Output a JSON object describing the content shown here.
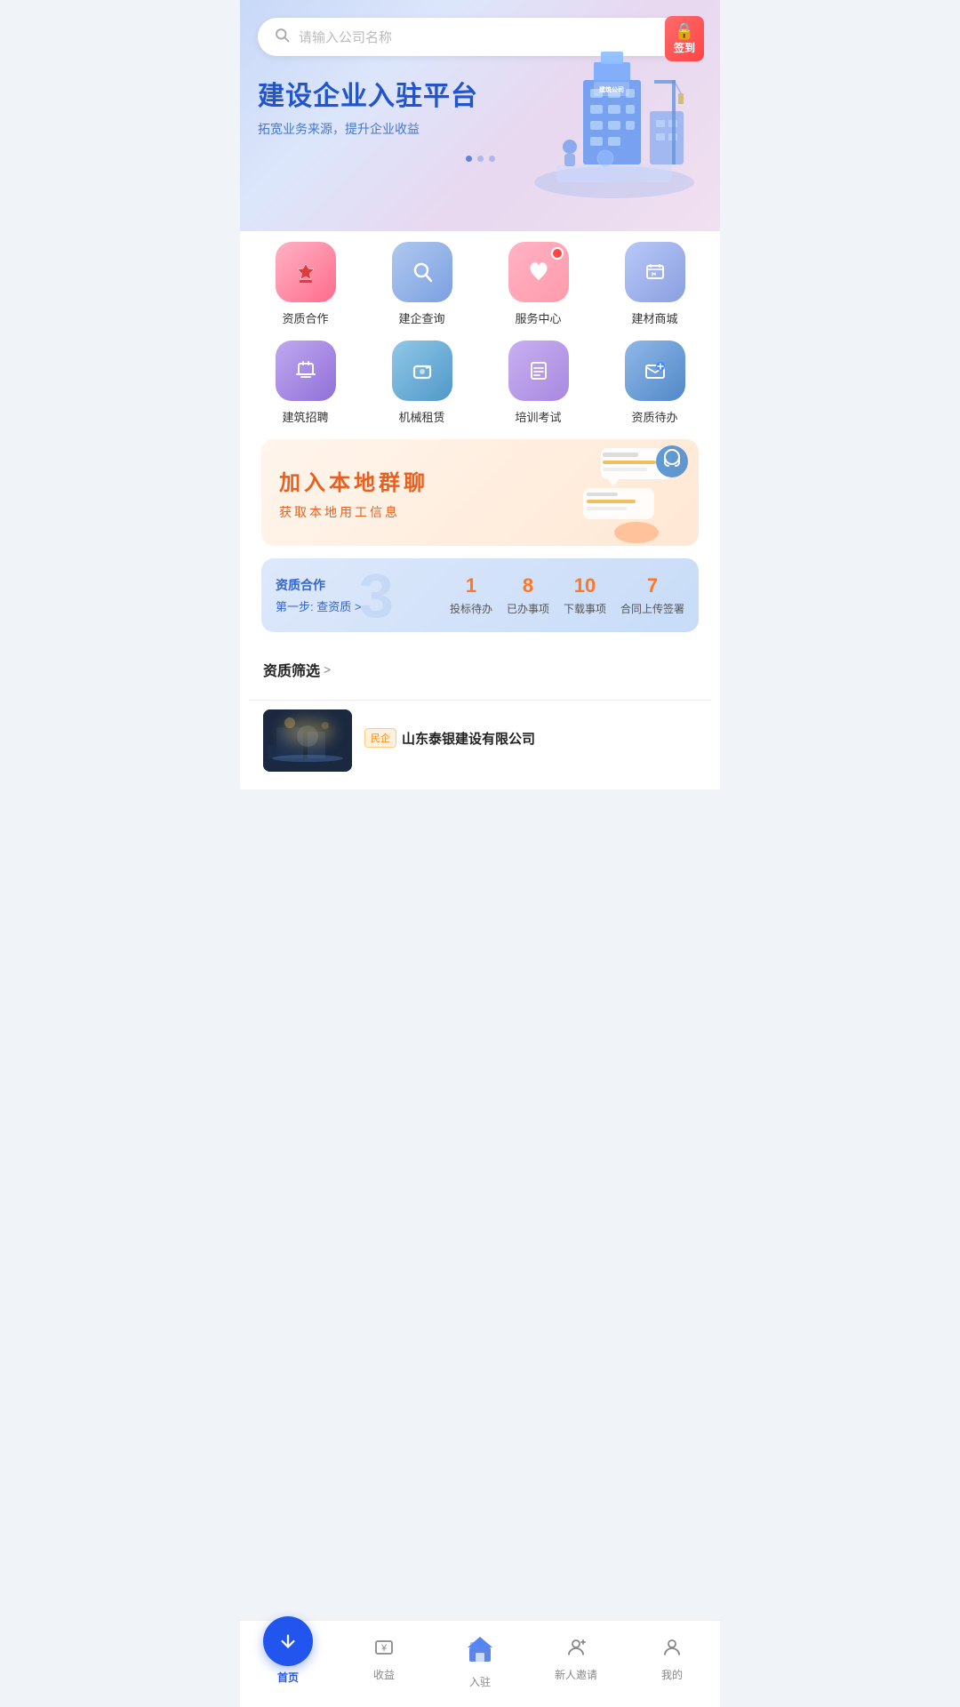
{
  "search": {
    "placeholder": "请输入公司名称"
  },
  "checkin": {
    "label": "签到"
  },
  "hero": {
    "title": "建设企业入驻平台",
    "subtitle": "拓宽业务来源，提升企业收益",
    "dots": [
      {
        "active": true
      },
      {
        "active": false
      },
      {
        "active": false
      }
    ],
    "building_label": "建筑公司"
  },
  "grid": {
    "items": [
      {
        "label": "资质合作",
        "icon": "⭐",
        "style": "pink-red",
        "badge": false
      },
      {
        "label": "建企查询",
        "icon": "🔍",
        "style": "blue-gray",
        "badge": false
      },
      {
        "label": "服务中心",
        "icon": "❤️",
        "style": "pink-light",
        "badge": true
      },
      {
        "label": "建材商城",
        "icon": "👜",
        "style": "purple-blue",
        "badge": false
      },
      {
        "label": "建筑招聘",
        "icon": "🎓",
        "style": "purple",
        "badge": false
      },
      {
        "label": "机械租赁",
        "icon": "🏷️",
        "style": "blue-teal",
        "badge": false
      },
      {
        "label": "培训考试",
        "icon": "📋",
        "style": "purple-light",
        "badge": false
      },
      {
        "label": "资质待办",
        "icon": "✉️",
        "style": "blue-envelope",
        "badge": false
      }
    ]
  },
  "join_banner": {
    "title": "加入本地群聊",
    "subtitle": "获取本地用工信息"
  },
  "stats": {
    "section_label": "资质合作",
    "section_link": "第一步: 查资质 >",
    "big_number": "3",
    "items": [
      {
        "num": "1",
        "label": "投标待办"
      },
      {
        "num": "8",
        "label": "已办事项"
      },
      {
        "num": "10",
        "label": "下载事项"
      },
      {
        "num": "7",
        "label": "合同上传签署"
      }
    ]
  },
  "filter": {
    "title": "资质筛选",
    "arrow": ">"
  },
  "company": {
    "tag": "民企",
    "name": "山东泰银建设有限公司"
  },
  "bottom_nav": {
    "items": [
      {
        "label": "首页",
        "icon": "⬇",
        "key": "home",
        "active": true
      },
      {
        "label": "收益",
        "icon": "¥",
        "key": "revenue",
        "active": false
      },
      {
        "label": "入驻",
        "icon": "🏠",
        "key": "settle",
        "active": false
      },
      {
        "label": "新人邀请",
        "icon": "👤",
        "key": "invite",
        "active": false
      },
      {
        "label": "我的",
        "icon": "👤",
        "key": "mine",
        "active": false
      }
    ]
  }
}
